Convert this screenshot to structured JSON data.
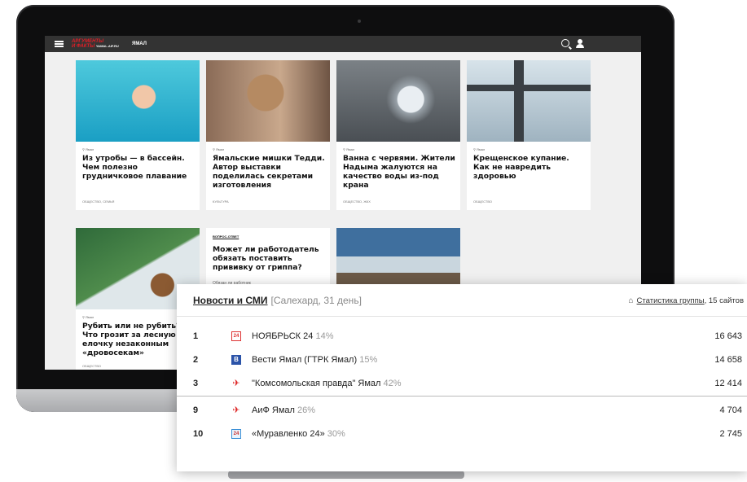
{
  "site": {
    "logo_top": "АРГУМЕНТЫ",
    "logo_bottom": "И ФАКТЫ",
    "logo_domain": "YAMAL.AIF.RU",
    "region": "ЯМАЛ"
  },
  "articles": [
    {
      "location": "Ямал",
      "title": "Из утробы — в бассейн. Чем полезно грудничковое плавание",
      "tags": "ОБЩЕСТВО, СЕМЬЯ"
    },
    {
      "location": "Ямал",
      "title": "Ямальские мишки Тедди. Автор выставки поделилась секретами изготовления",
      "tags": "КУЛЬТУРА"
    },
    {
      "location": "Ямал",
      "title": "Ванна с червями. Жители Надыма жалуются на качество воды из-под крана",
      "tags": "ОБЩЕСТВО, ЖКХ"
    },
    {
      "location": "Ямал",
      "title": "Крещенское купание. Как не навредить здоровью",
      "tags": "ОБЩЕСТВО"
    },
    {
      "location": "Ямал",
      "title": "Рубить или не рубить? Что грозит за лесную елочку незаконным «дровосекам»",
      "tags": "ОБЩЕСТВО"
    },
    {
      "kicker": "ВОПРОС-ОТВЕТ",
      "title": "Может ли работодатель обязать поставить прививку от гриппа?",
      "subtitle": "Обязан ли работник"
    }
  ],
  "panel": {
    "title": "Новости и СМИ",
    "meta": "[Салехард, 31 день]",
    "stats_link": "Статистика группы",
    "stats_suffix": ", 15 сайтов",
    "rows": [
      {
        "rank": "1",
        "icon": "24",
        "name": "НОЯБРЬСК 24",
        "pct": "14%",
        "value": "16 643"
      },
      {
        "rank": "2",
        "icon": "В",
        "name": "Вести Ямал (ГТРК Ямал)",
        "pct": "15%",
        "value": "14 658"
      },
      {
        "rank": "3",
        "icon": "✈",
        "name": "\"Комсомольская правда\" Ямал",
        "pct": "42%",
        "value": "12 414"
      },
      {
        "rank": "9",
        "icon": "✈",
        "name": "АиФ Ямал",
        "pct": "26%",
        "value": "4 704"
      },
      {
        "rank": "10",
        "icon": "24",
        "name": "«Муравленко 24»",
        "pct": "30%",
        "value": "2 745"
      }
    ]
  }
}
